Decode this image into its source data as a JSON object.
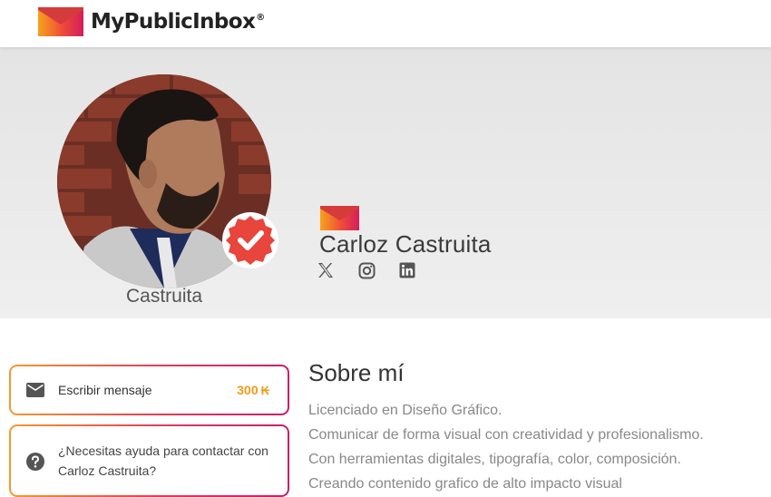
{
  "header": {
    "logo_text": "MyPublicInbox",
    "logo_reg": "®"
  },
  "profile": {
    "username": "Castruita",
    "display_name": "Carloz Castruita",
    "verified": true,
    "socials": [
      {
        "name": "x",
        "icon": "x-icon"
      },
      {
        "name": "instagram",
        "icon": "instagram-icon"
      },
      {
        "name": "linkedin",
        "icon": "linkedin-icon"
      }
    ]
  },
  "actions": {
    "message_label": "Escribir mensaje",
    "message_price": "300",
    "help_line1": "¿Necesitas ayuda para contactar con",
    "help_line2": "Carloz Castruita?"
  },
  "about": {
    "title": "Sobre mí",
    "lines": [
      "Licenciado en Diseño Gráfico.",
      "Comunicar de forma visual con creatividad y profesionalismo.",
      "Con herramientas digitales, tipografía, color, composición.",
      "Creando contenido grafico de alto impacto visual"
    ]
  },
  "colors": {
    "brand_orange": "#f39a2e",
    "brand_red": "#e4385a",
    "brand_magenta": "#c81d6a",
    "price": "#f09b1a",
    "verified_badge": "#e8453c"
  }
}
